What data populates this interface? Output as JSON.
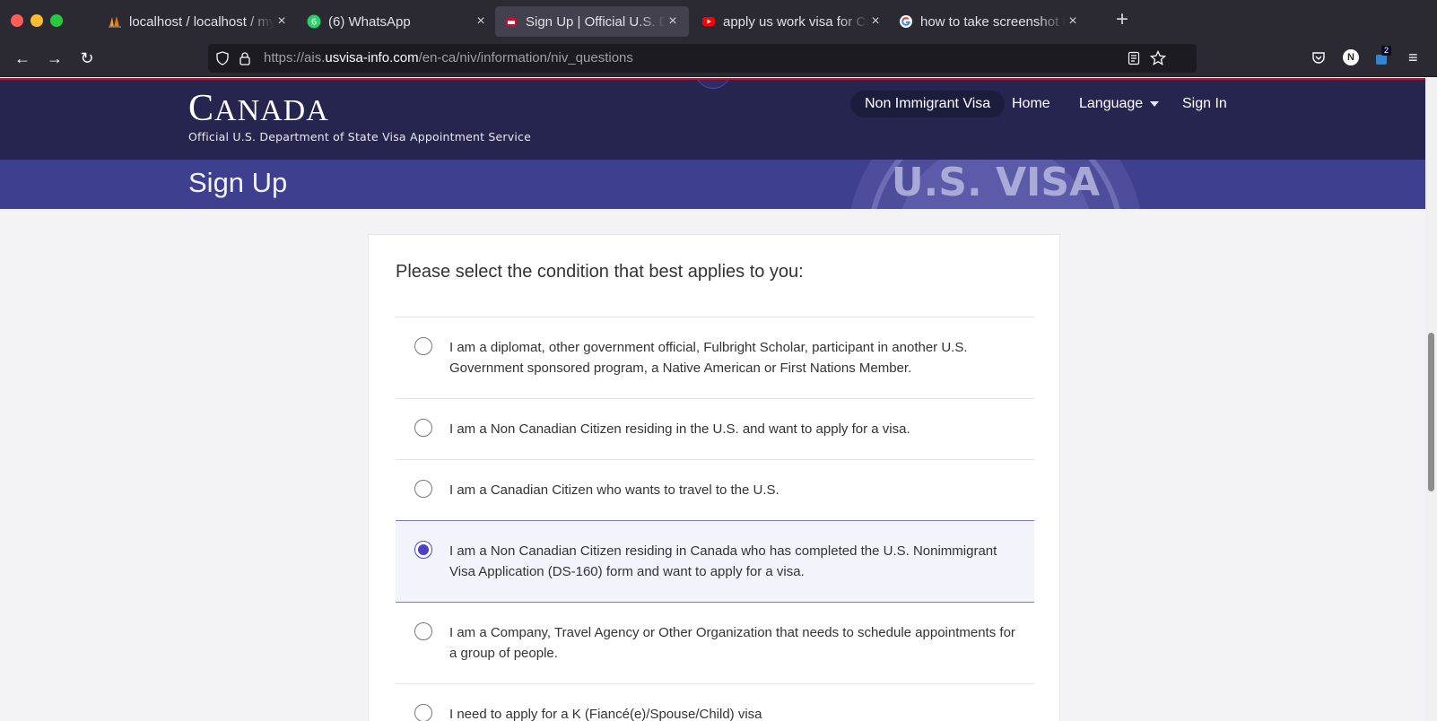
{
  "tabs": [
    {
      "title": "localhost / localhost / my",
      "icon": "phpmyadmin-icon"
    },
    {
      "title": "(6) WhatsApp",
      "icon": "whatsapp-icon"
    },
    {
      "title": "Sign Up | Official U.S. Dep",
      "icon": "usvisa-icon",
      "active": true
    },
    {
      "title": "apply us work visa for Ca",
      "icon": "youtube-icon"
    },
    {
      "title": "how to take screenshot in",
      "icon": "google-icon"
    }
  ],
  "url": {
    "prefix": "https://ais.",
    "host": "usvisa-info.com",
    "path": "/en-ca/niv/information/niv_questions"
  },
  "extension_badge": "2",
  "account_initial": "N",
  "site": {
    "brand_first": "C",
    "brand_rest": "ANADA",
    "subtitle": "Official U.S. Department of State Visa Appointment Service",
    "nav": {
      "niv": "Non Immigrant Visa",
      "home": "Home",
      "language": "Language",
      "signin": "Sign In"
    },
    "page_title": "Sign Up",
    "seal_text": "U.S. VISA"
  },
  "form": {
    "heading": "Please select the condition that best applies to you:",
    "options": [
      "I am a diplomat, other government official, Fulbright Scholar, participant in another U.S. Government sponsored program, a Native American or First Nations Member.",
      "I am a Non Canadian Citizen residing in the U.S. and want to apply for a visa.",
      "I am a Canadian Citizen who wants to travel to the U.S.",
      "I am a Non Canadian Citizen residing in Canada who has completed the U.S. Nonimmigrant Visa Application (DS-160) form and want to apply for a visa.",
      "I am a Company, Travel Agency or Other Organization that needs to schedule appointments for a group of people.",
      "I need to apply for a K (Fiancé(e)/Spouse/Child) visa"
    ],
    "selected_index": 3
  }
}
